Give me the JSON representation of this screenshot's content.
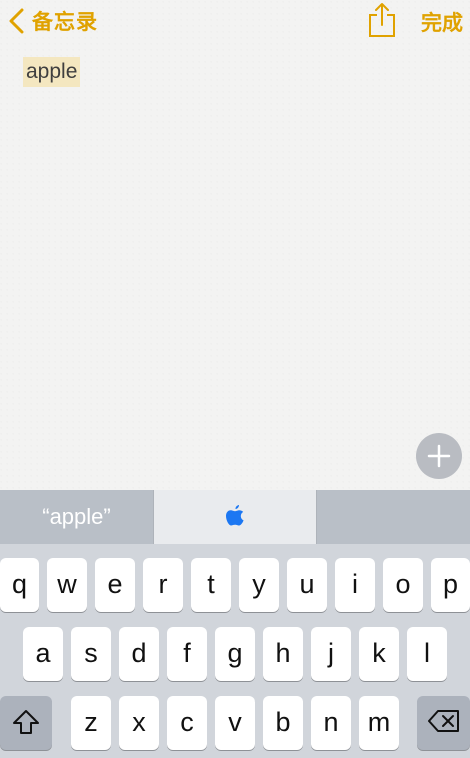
{
  "nav": {
    "back_label": "备忘录",
    "done_label": "完成",
    "share_icon": "share-icon"
  },
  "note": {
    "text": "apple"
  },
  "keyboard": {
    "suggestions": [
      "“apple”",
      "",
      ""
    ],
    "suggestion_center_icon": "apple-logo-icon",
    "row1": [
      "q",
      "w",
      "e",
      "r",
      "t",
      "y",
      "u",
      "i",
      "o",
      "p"
    ],
    "row2": [
      "a",
      "s",
      "d",
      "f",
      "g",
      "h",
      "j",
      "k",
      "l"
    ],
    "row3": [
      "z",
      "x",
      "c",
      "v",
      "b",
      "n",
      "m"
    ],
    "shift_icon": "shift-icon",
    "delete_icon": "delete-icon"
  },
  "colors": {
    "accent": "#e0a200",
    "highlight": "#f4e7c0",
    "keyboard_bg": "#d1d5db"
  }
}
